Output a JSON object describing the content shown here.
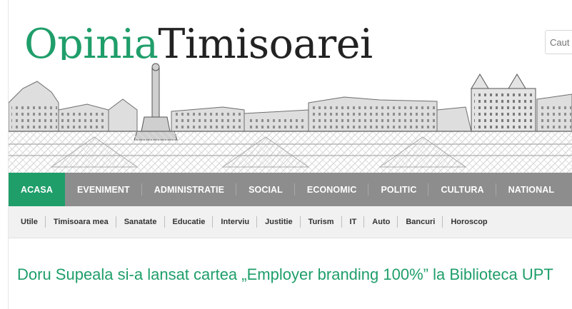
{
  "logo": {
    "part1": "Opinia",
    "part2": "Timisoarei"
  },
  "search": {
    "placeholder": "Caut"
  },
  "menu": {
    "items": [
      {
        "label": "ACASA"
      },
      {
        "label": "EVENIMENT"
      },
      {
        "label": "ADMINISTRATIE"
      },
      {
        "label": "SOCIAL"
      },
      {
        "label": "ECONOMIC"
      },
      {
        "label": "POLITIC"
      },
      {
        "label": "CULTURA"
      },
      {
        "label": "NATIONAL"
      }
    ]
  },
  "submenu": {
    "items": [
      {
        "label": "Utile"
      },
      {
        "label": "Timisoara mea"
      },
      {
        "label": "Sanatate"
      },
      {
        "label": "Educatie"
      },
      {
        "label": "Interviu"
      },
      {
        "label": "Justitie"
      },
      {
        "label": "Turism"
      },
      {
        "label": "IT"
      },
      {
        "label": "Auto"
      },
      {
        "label": "Bancuri"
      },
      {
        "label": "Horoscop"
      }
    ]
  },
  "article": {
    "title": "Doru Supeala si-a lansat cartea „Employer branding 100%” la Biblioteca UPT"
  },
  "colors": {
    "brand": "#1f9e6a",
    "menu_bg": "#8d8d8d",
    "submenu_bg": "#f1f1f1"
  }
}
